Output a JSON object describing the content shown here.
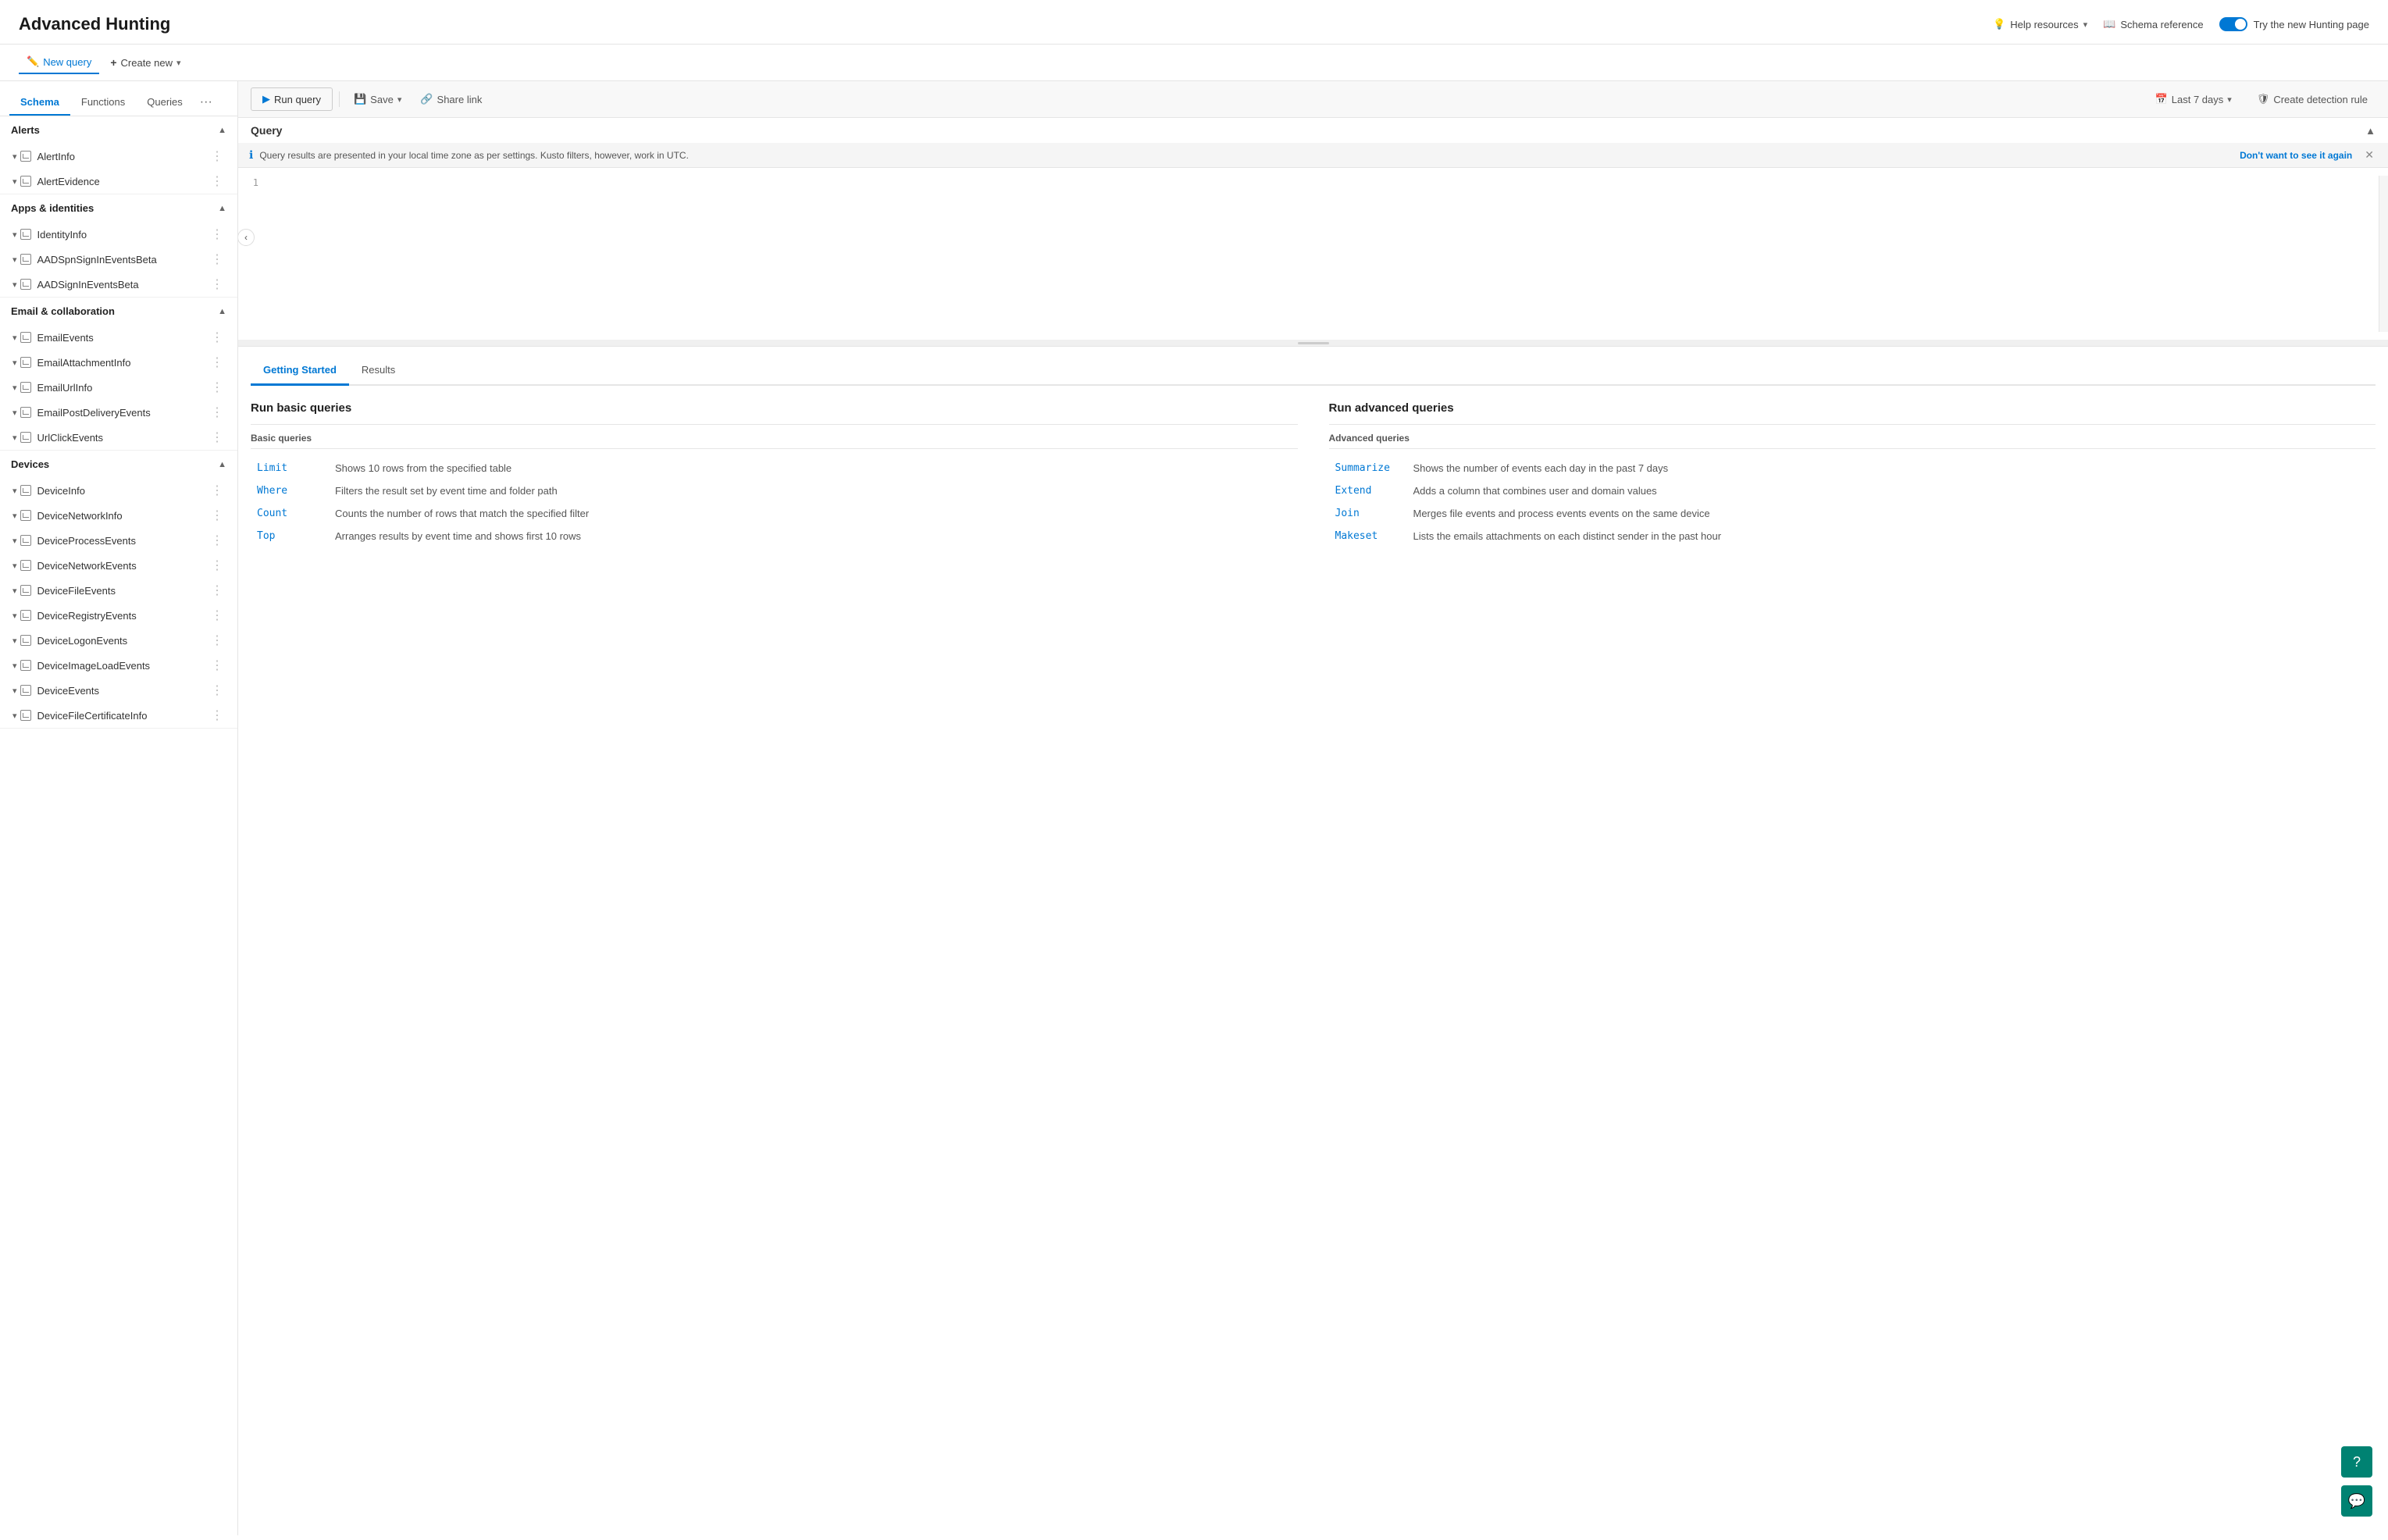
{
  "header": {
    "title": "Advanced Hunting",
    "help_label": "Help resources",
    "schema_ref_label": "Schema reference",
    "try_new_label": "Try the new Hunting page"
  },
  "new_query_label": "New query",
  "create_new_label": "Create new",
  "sidebar": {
    "tabs": [
      "Schema",
      "Functions",
      "Queries"
    ],
    "active_tab": "Schema",
    "groups": [
      {
        "name": "Alerts",
        "items": [
          "AlertInfo",
          "AlertEvidence"
        ]
      },
      {
        "name": "Apps & identities",
        "items": [
          "IdentityInfo",
          "AADSpnSignInEventsBeta",
          "AADSignInEventsBeta"
        ]
      },
      {
        "name": "Email & collaboration",
        "items": [
          "EmailEvents",
          "EmailAttachmentInfo",
          "EmailUrlInfo",
          "EmailPostDeliveryEvents",
          "UrlClickEvents"
        ]
      },
      {
        "name": "Devices",
        "items": [
          "DeviceInfo",
          "DeviceNetworkInfo",
          "DeviceProcessEvents",
          "DeviceNetworkEvents",
          "DeviceFileEvents",
          "DeviceRegistryEvents",
          "DeviceLogonEvents",
          "DeviceImageLoadEvents",
          "DeviceEvents",
          "DeviceFileCertificateInfo"
        ]
      }
    ]
  },
  "query_toolbar": {
    "run_query": "Run query",
    "save": "Save",
    "share_link": "Share link",
    "time_range": "Last 7 days",
    "create_detection_rule": "Create detection rule"
  },
  "query_section": {
    "label": "Query",
    "info_text": "Query results are presented in your local time zone as per settings. Kusto filters, however, work in UTC.",
    "dont_show": "Don't want to see it again",
    "line_number": "1",
    "code_value": ""
  },
  "results": {
    "tabs": [
      "Getting Started",
      "Results"
    ],
    "active_tab": "Getting Started",
    "basic_queries_title": "Run basic queries",
    "advanced_queries_title": "Run advanced queries",
    "basic_subtitle": "Basic queries",
    "advanced_subtitle": "Advanced queries",
    "basic_rows": [
      {
        "cmd": "Limit",
        "desc": "Shows 10 rows from the specified table"
      },
      {
        "cmd": "Where",
        "desc": "Filters the result set by event time and folder path"
      },
      {
        "cmd": "Count",
        "desc": "Counts the number of rows that match the specified filter"
      },
      {
        "cmd": "Top",
        "desc": "Arranges results by event time and shows first 10 rows"
      }
    ],
    "advanced_rows": [
      {
        "cmd": "Summarize",
        "desc": "Shows the number of events each day in the past 7 days"
      },
      {
        "cmd": "Extend",
        "desc": "Adds a column that combines user and domain values"
      },
      {
        "cmd": "Join",
        "desc": "Merges file events and process events events on the same device"
      },
      {
        "cmd": "Makeset",
        "desc": "Lists the emails attachments on each distinct sender in the past hour"
      }
    ]
  },
  "bottom_btns": [
    "❓",
    "💬"
  ]
}
